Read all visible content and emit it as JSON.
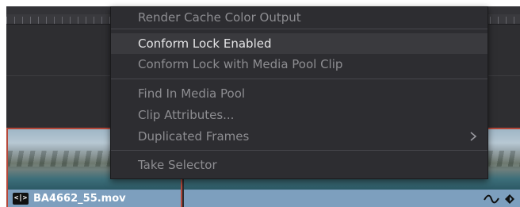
{
  "context_menu": {
    "items": [
      {
        "label": "Render Cache Color Output"
      },
      {
        "label": "Conform Lock Enabled"
      },
      {
        "label": "Conform Lock with Media Pool Clip"
      },
      {
        "label": "Find In Media Pool"
      },
      {
        "label": "Clip Attributes..."
      },
      {
        "label": "Duplicated Frames"
      },
      {
        "label": "Take Selector"
      }
    ],
    "submenu_arrow_icon": "chevron-right-icon"
  },
  "timeline": {
    "clip_name": "BA4662_55.mov",
    "link_icon_glyph": "<|>"
  },
  "colors": {
    "menu_bg": "#2d2d31",
    "menu_text_active": "#e6e6e8",
    "menu_text_dim": "#8d8d91",
    "clip_bar": "#7d9fbe",
    "clip_selection_border": "#b5483a"
  }
}
